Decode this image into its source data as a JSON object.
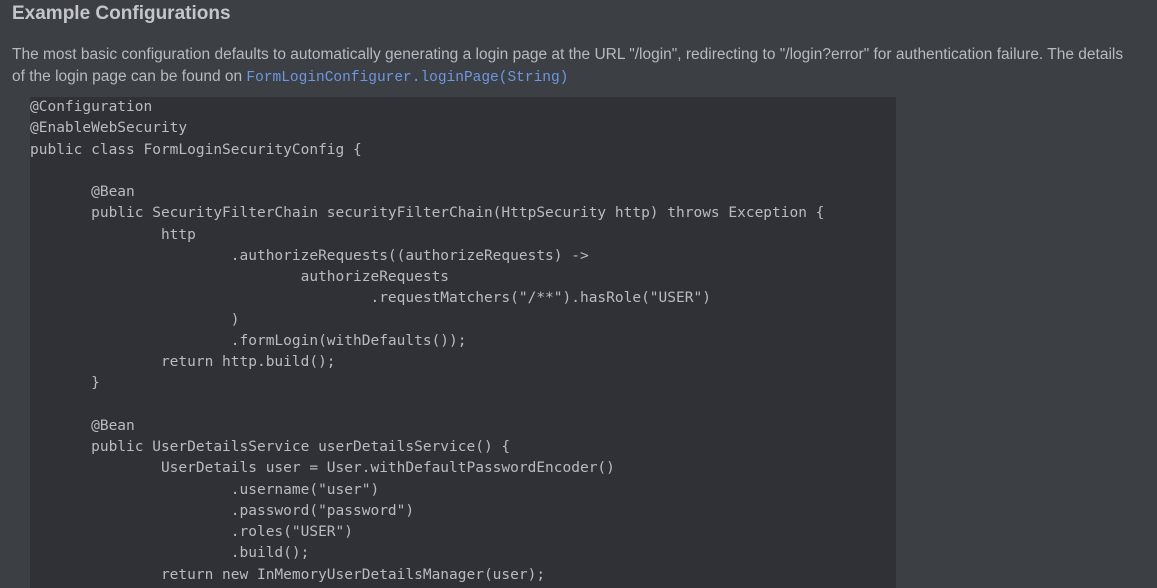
{
  "doc": {
    "title": "Example Configurations",
    "description_text": "The most basic configuration defaults to automatically generating a login page at the URL \"/login\", redirecting to \"/login?error\" for authentication failure. The details of the login page can be found on ",
    "description_link": "FormLoginConfigurer.loginPage(String)",
    "code": "@Configuration\n@EnableWebSecurity\npublic class FormLoginSecurityConfig {\n\n       @Bean\n       public SecurityFilterChain securityFilterChain(HttpSecurity http) throws Exception {\n               http\n                       .authorizeRequests((authorizeRequests) ->\n                               authorizeRequests\n                                       .requestMatchers(\"/**\").hasRole(\"USER\")\n                       )\n                       .formLogin(withDefaults());\n               return http.build();\n       }\n\n       @Bean\n       public UserDetailsService userDetailsService() {\n               UserDetails user = User.withDefaultPasswordEncoder()\n                       .username(\"user\")\n                       .password(\"password\")\n                       .roles(\"USER\")\n                       .build();\n               return new InMemoryUserDetailsManager(user);"
  },
  "colors": {
    "background": "#3c3f44",
    "code_background": "#2f3136",
    "text": "#b7bbc1",
    "title": "#c3c6cb",
    "link": "#6e97e0"
  }
}
